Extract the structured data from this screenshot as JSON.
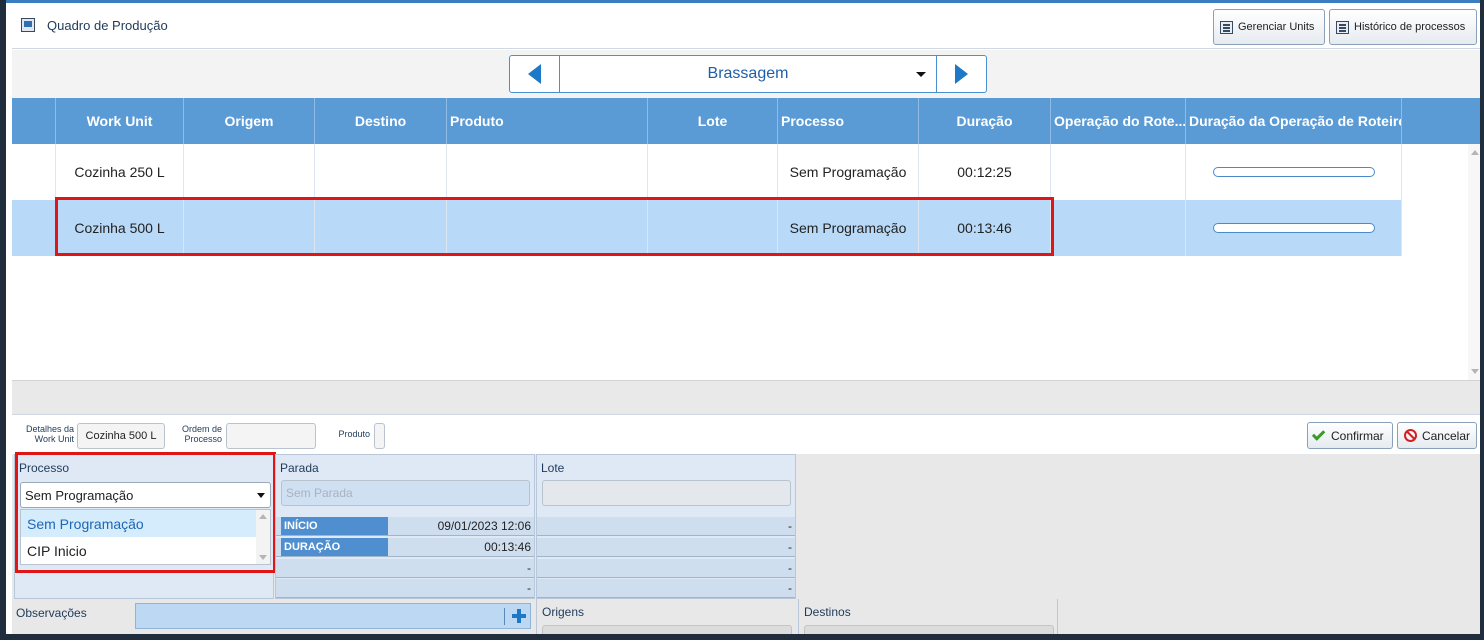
{
  "header": {
    "title": "Quadro de Produção",
    "buttons": {
      "gerenciar": "Gerenciar Units",
      "historico": "Histórico de processos"
    }
  },
  "navigator": {
    "selected": "Brassagem"
  },
  "grid": {
    "columns": [
      "Work Unit",
      "Origem",
      "Destino",
      "Produto",
      "Lote",
      "Processo",
      "Duração",
      "Operação do Rote...",
      "Duração da Operação de Roteiro"
    ],
    "rows": [
      {
        "work_unit": "Cozinha 250 L",
        "origem": "",
        "destino": "",
        "produto": "",
        "lote": "",
        "processo": "Sem Programação",
        "duracao": "00:12:25",
        "operacao": "",
        "progress": 0
      },
      {
        "work_unit": "Cozinha 500 L",
        "origem": "",
        "destino": "",
        "produto": "",
        "lote": "",
        "processo": "Sem Programação",
        "duracao": "00:13:46",
        "operacao": "",
        "progress": 0
      }
    ],
    "selected_row": 1
  },
  "details": {
    "work_unit_label": "Detalhes da Work Unit",
    "work_unit_value": "Cozinha 500 L",
    "ordem_label": "Ordem de Processo",
    "ordem_value": "",
    "produto_label": "Produto",
    "produto_value": "",
    "confirm": "Confirmar",
    "cancel": "Cancelar"
  },
  "form": {
    "processo_label": "Processo",
    "processo_value": "Sem Programação",
    "processo_options": [
      "Sem Programação",
      "CIP Inicio"
    ],
    "parada_label": "Parada",
    "parada_placeholder": "Sem Parada",
    "lote_label": "Lote",
    "lote_value": "",
    "inicio_label": "INÍCIO",
    "inicio_value": "09/01/2023 12:06",
    "duracao_label": "DURAÇÃO",
    "duracao_value": "00:13:46",
    "dash": "-",
    "observacoes_label": "Observações",
    "origens_label": "Origens",
    "destinos_label": "Destinos"
  },
  "colors": {
    "header_blue": "#5b9bd5",
    "selected_row": "#b8d9f7",
    "highlight_red": "#e01616",
    "accent": "#1e78c8"
  }
}
